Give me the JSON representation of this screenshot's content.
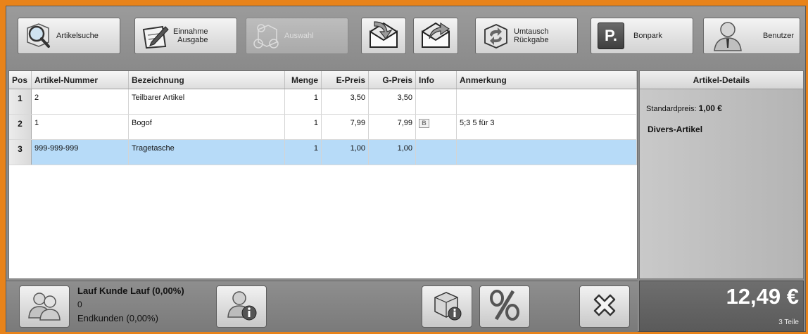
{
  "toolbar": {
    "artikelsuche": "Artikelsuche",
    "einnahme_ausgabe": "Einnahme\nAusgabe",
    "auswahl": "Auswahl",
    "umtausch_rueckgabe": "Umtausch\nRückgabe",
    "bonpark": "Bonpark",
    "bonpark_icon_letter": "P.",
    "benutzer": "Benutzer"
  },
  "grid": {
    "headers": [
      "Pos",
      "Artikel-Nummer",
      "Bezeichnung",
      "Menge",
      "E-Preis",
      "G-Preis",
      "Info",
      "Anmerkung"
    ],
    "rows": [
      {
        "pos": "1",
        "artikel": "2",
        "bezeichnung": "Teilbarer Artikel",
        "menge": "1",
        "epreis": "3,50",
        "gpreis": "3,50",
        "info": "",
        "anmerkung": ""
      },
      {
        "pos": "2",
        "artikel": "1",
        "bezeichnung": "Bogof",
        "menge": "1",
        "epreis": "7,99",
        "gpreis": "7,99",
        "info": "B",
        "anmerkung": "5;3 5 für 3"
      },
      {
        "pos": "3",
        "artikel": "999-999-999",
        "bezeichnung": "Tragetasche",
        "menge": "1",
        "epreis": "1,00",
        "gpreis": "1,00",
        "info": "",
        "anmerkung": ""
      }
    ],
    "selected_row": 3
  },
  "details": {
    "title": "Artikel-Details",
    "standardpreis_label": "Standardpreis:",
    "standardpreis_value": "1,00 €",
    "artikel_typ": "Divers-Artikel"
  },
  "customer": {
    "name": "Lauf Kunde Lauf (0,00%)",
    "value": "0",
    "endkunden": "Endkunden (0,00%)"
  },
  "totals": {
    "amount": "12,49 €",
    "teile": "3 Teile"
  },
  "colors": {
    "frame": "#e8831a",
    "selection": "#b7dbf8"
  }
}
